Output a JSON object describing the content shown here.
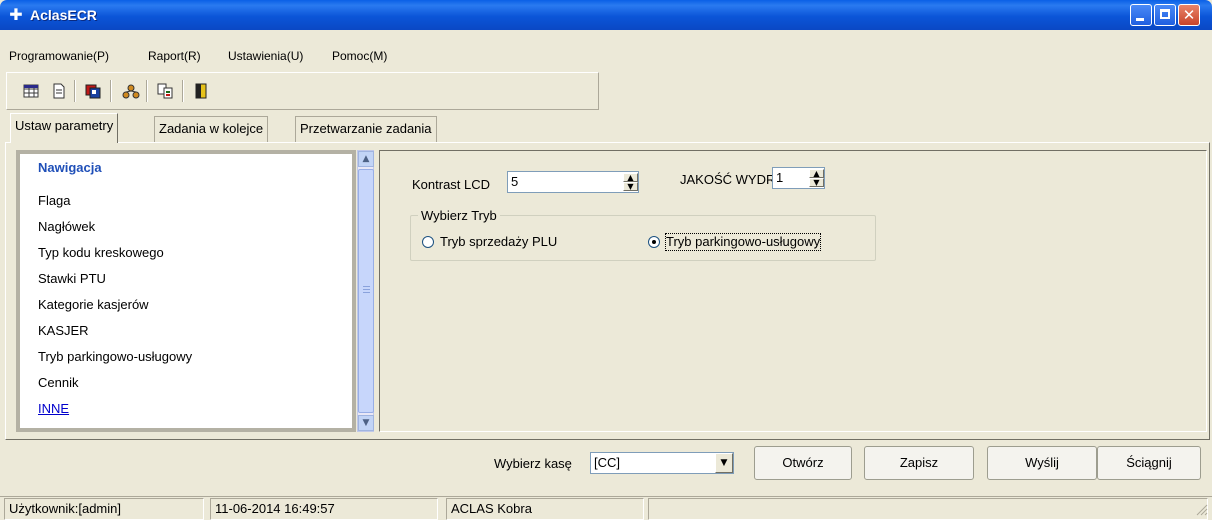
{
  "window": {
    "title": "AclasECR"
  },
  "menu": [
    "Programowanie(P)",
    "Raport(R)",
    "Ustawienia(U)",
    "Pomoc(M)"
  ],
  "toolbar": {
    "icons": [
      "grid-icon",
      "document-icon",
      "card-icon",
      "network-icon",
      "copy-icon",
      "exit-door-icon"
    ]
  },
  "tabs": [
    "Ustaw parametry",
    "Zadania w kolejce",
    "Przetwarzanie zadania"
  ],
  "nav": {
    "title": "Nawigacja",
    "items": [
      "Flaga",
      "Nagłówek",
      "Typ kodu kreskowego",
      "Stawki PTU",
      "Kategorie kasjerów",
      "KASJER",
      "Tryb parkingowo-usługowy",
      "Cennik",
      "INNE"
    ]
  },
  "form": {
    "contrast_label": "Kontrast LCD",
    "contrast_value": "5",
    "quality_label": "JAKOŚĆ WYDR",
    "quality_value": "1",
    "mode_group_label": "Wybierz Tryb",
    "mode_options": [
      "Tryb sprzedaży PLU",
      "Tryb parkingowo-usługowy"
    ],
    "mode_selected": "Tryb parkingowo-usługowy"
  },
  "bottom": {
    "cash_label": "Wybierz kasę",
    "cash_value": "[CC]",
    "buttons": [
      "Otwórz",
      "Zapisz",
      "Wyślij",
      "Ściągnij"
    ]
  },
  "status": {
    "user": "Użytkownik:[admin]",
    "datetime": "11-06-2014 16:49:57",
    "device": "ACLAS Kobra"
  },
  "colors": {
    "title_bar": "#0a55d8",
    "nav_title": "#1f4fb8",
    "link": "#0000cc"
  }
}
